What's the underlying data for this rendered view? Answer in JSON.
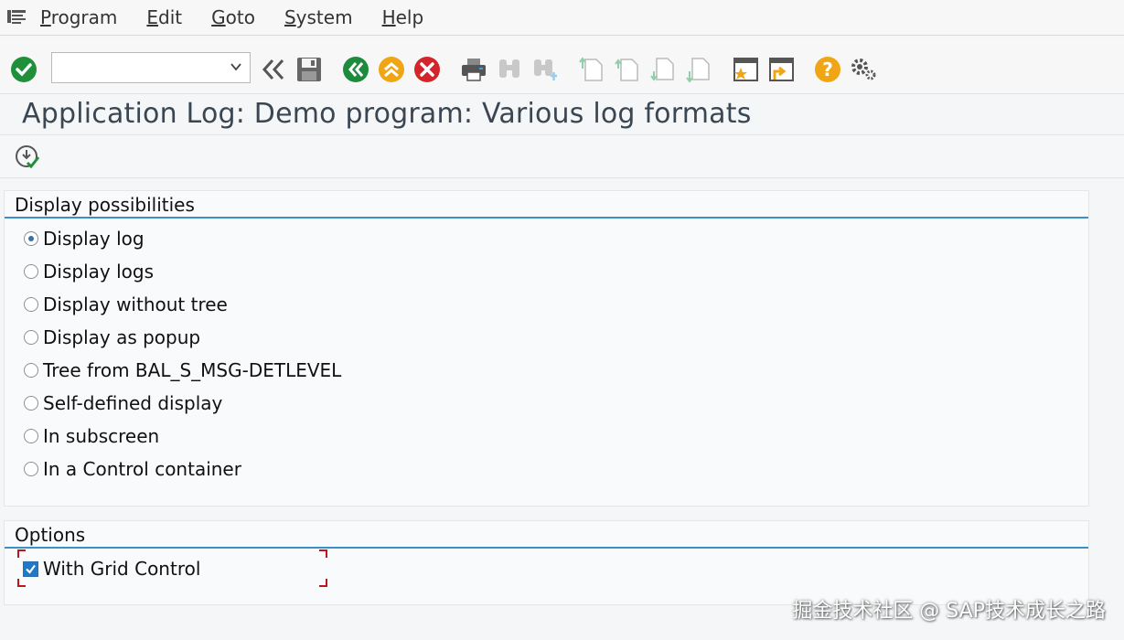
{
  "menu": {
    "items": [
      {
        "underline": "P",
        "rest": "rogram"
      },
      {
        "underline": "E",
        "rest": "dit"
      },
      {
        "underline": "G",
        "rest": "oto"
      },
      {
        "underline": "S",
        "rest": "ystem"
      },
      {
        "underline": "H",
        "rest": "elp"
      }
    ]
  },
  "toolbar": {
    "command_field_value": "",
    "icons": [
      "enter-icon",
      "back-history-icon",
      "save-icon",
      "back-icon",
      "exit-icon",
      "cancel-icon",
      "print-icon",
      "find-icon",
      "find-next-icon",
      "first-page-icon",
      "previous-page-icon",
      "next-page-icon",
      "last-page-icon",
      "create-session-icon",
      "shortcut-icon",
      "help-icon",
      "customize-layout-icon"
    ]
  },
  "title": "Application Log: Demo program: Various log formats",
  "groups": {
    "display": {
      "title": "Display possibilities",
      "options": [
        {
          "label": "Display log",
          "checked": true
        },
        {
          "label": "Display logs",
          "checked": false
        },
        {
          "label": "Display without tree",
          "checked": false
        },
        {
          "label": "Display as popup",
          "checked": false
        },
        {
          "label": "Tree from BAL_S_MSG-DETLEVEL",
          "checked": false
        },
        {
          "label": "Self-defined display",
          "checked": false
        },
        {
          "label": "In subscreen",
          "checked": false
        },
        {
          "label": "In a Control container",
          "checked": false
        }
      ]
    },
    "options": {
      "title": "Options",
      "checkbox_label": "With Grid Control",
      "checkbox_checked": true
    }
  },
  "watermark": "掘金技术社区 @ SAP技术成长之路",
  "colors": {
    "accent": "#3c8fc9",
    "enter_green": "#1f8f3a",
    "back_green": "#1e8a3c",
    "exit_orange": "#f0a614",
    "cancel_red": "#d3262a",
    "help_orange": "#f0a614"
  }
}
